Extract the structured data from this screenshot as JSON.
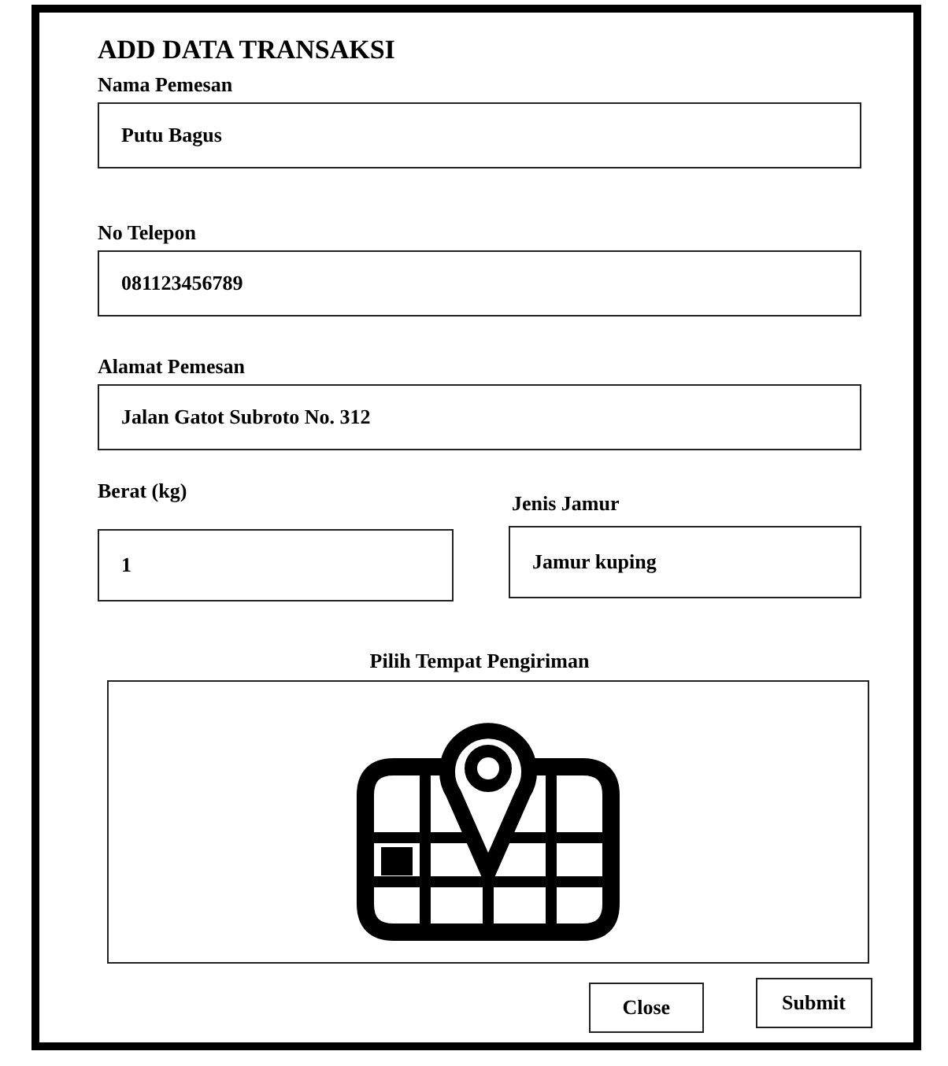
{
  "title": "ADD DATA TRANSAKSI",
  "fields": [
    {
      "label": "Nama Pemesan",
      "value": "Putu Bagus"
    },
    {
      "label": "No Telepon",
      "value": "081123456789"
    },
    {
      "label": "Alamat Pemesan",
      "value": "Jalan Gatot Subroto No. 312"
    }
  ],
  "pair": [
    {
      "label": "Berat (kg)",
      "value": "1"
    },
    {
      "label": "Jenis Jamur",
      "value": "Jamur kuping"
    }
  ],
  "map": {
    "label": "Pilih Tempat Pengiriman"
  },
  "buttons": [
    "Close",
    "Submit"
  ]
}
